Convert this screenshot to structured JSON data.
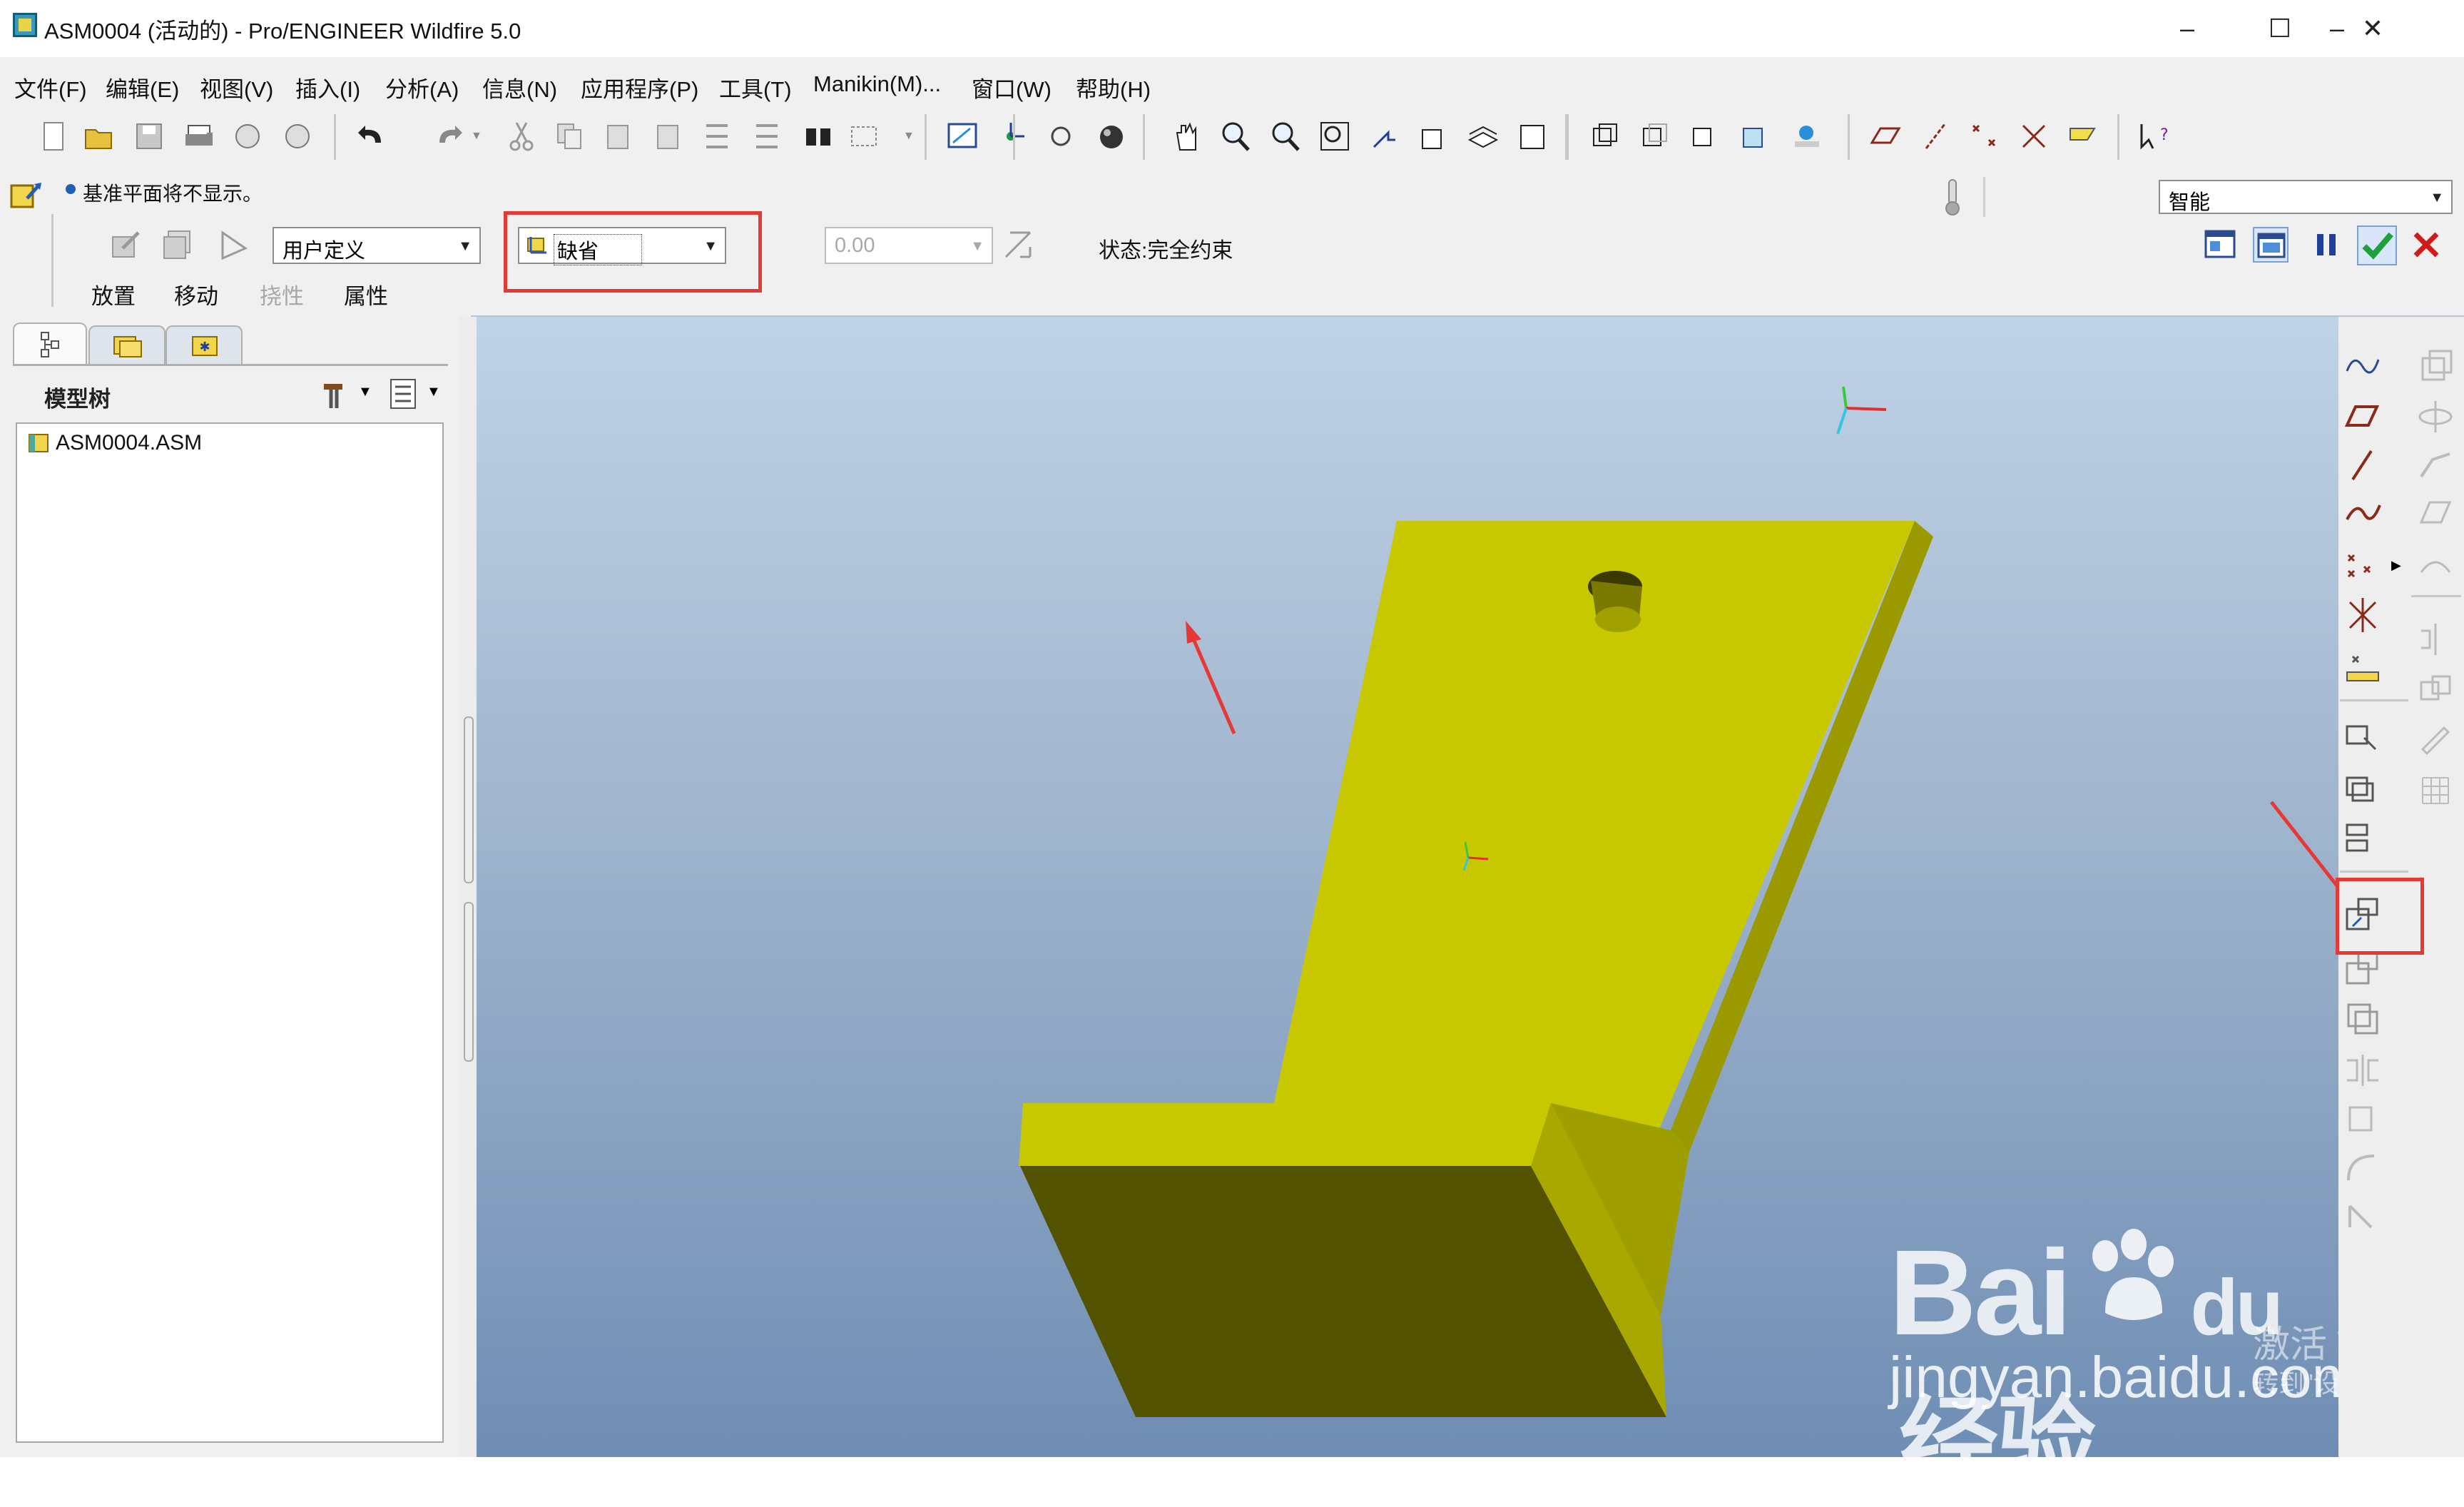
{
  "window": {
    "title": "ASM0004 (活动的) - Pro/ENGINEER Wildfire 5.0",
    "minimize": "–",
    "maximize": "☐",
    "close": "✕"
  },
  "menu": [
    "文件(F)",
    "编辑(E)",
    "视图(V)",
    "插入(I)",
    "分析(A)",
    "信息(N)",
    "应用程序(P)",
    "工具(T)",
    "Manikin(M)...",
    "窗口(W)",
    "帮助(H)"
  ],
  "dashboard": {
    "message": "基准平面将不显示。",
    "constraint_set": "用户定义",
    "constraint_type": "缺省",
    "offset_value": "0.00",
    "status": "状态:完全约束",
    "filter": "智能",
    "tabs": [
      "放置",
      "移动",
      "挠性",
      "属性"
    ]
  },
  "model_tree": {
    "header": "模型树",
    "root": "ASM0004.ASM"
  },
  "watermark": {
    "brand": "Bai",
    "brand_suffix": "du",
    "brand_cn": "经验",
    "url": "jingyan.baidu.com",
    "activate": "激活 Window",
    "activate_sub": "转到\"设置\"以激活"
  },
  "colors": {
    "part_top": "#c8c800",
    "part_side": "#a8a800",
    "part_dark": "#525200",
    "highlight": "#e53935"
  }
}
